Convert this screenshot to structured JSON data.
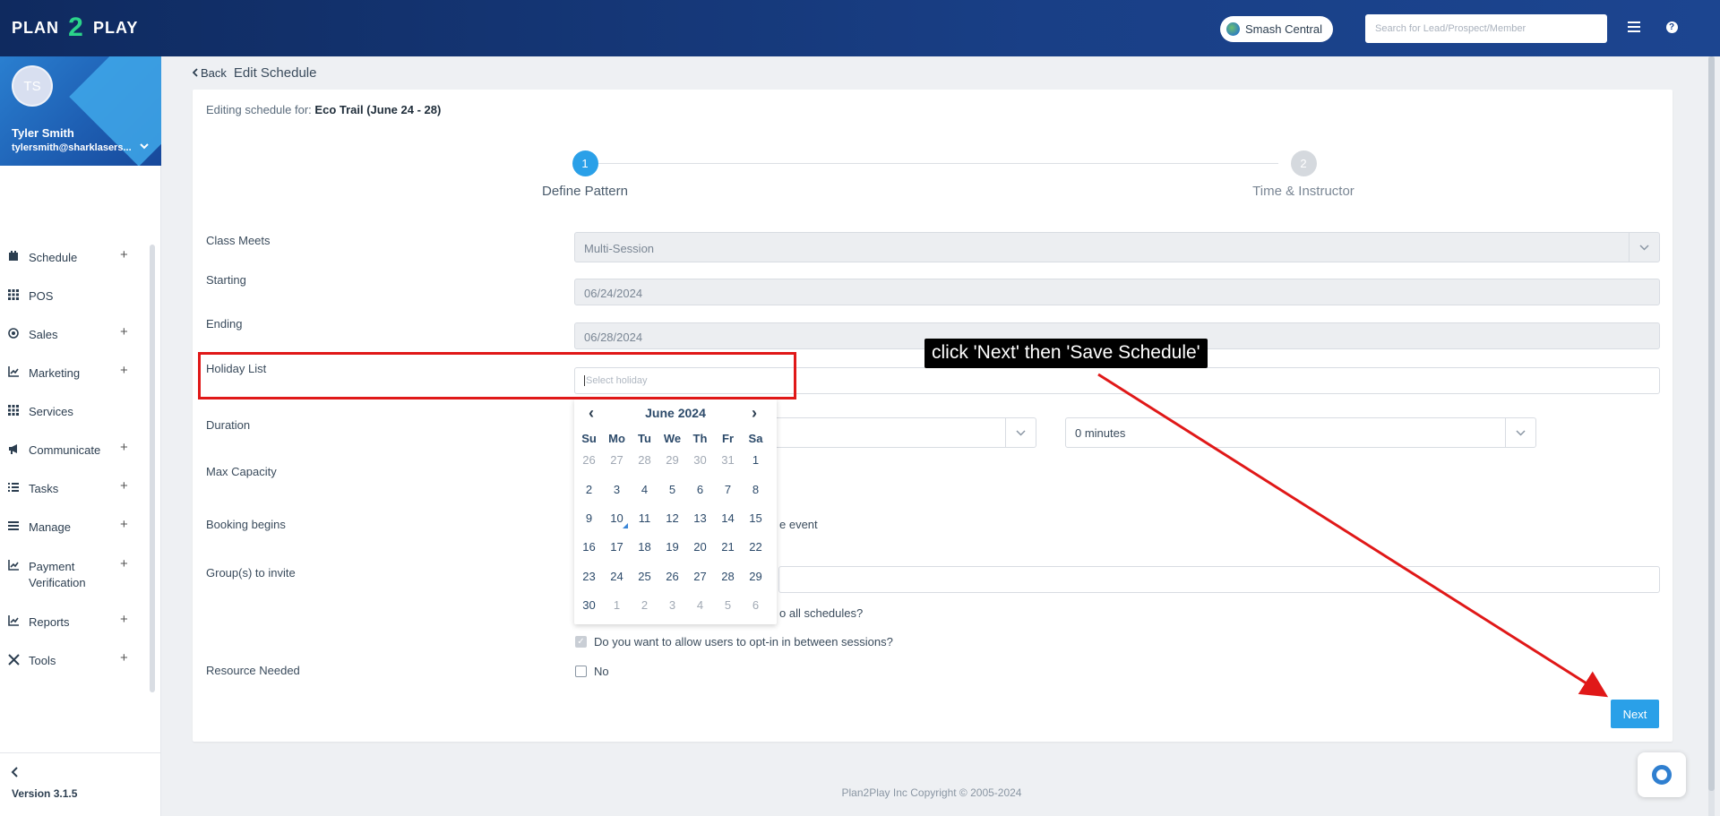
{
  "topbar": {
    "logo_left": "PLAN",
    "logo_mid": "2",
    "logo_right": "PLAY",
    "location": "Smash Central",
    "search_placeholder": "Search for Lead/Prospect/Member",
    "menu_icon": "hamburger-icon",
    "help_icon": "help-icon"
  },
  "profile": {
    "initials": "TS",
    "name": "Tyler Smith",
    "email": "tylersmith@sharklasers..."
  },
  "sidebar": {
    "items": [
      {
        "label": "Schedule",
        "icon": "calendar-icon",
        "expandable": true
      },
      {
        "label": "POS",
        "icon": "grid-icon",
        "expandable": false
      },
      {
        "label": "Sales",
        "icon": "target-icon",
        "expandable": true
      },
      {
        "label": "Marketing",
        "icon": "chart-icon",
        "expandable": true
      },
      {
        "label": "Services",
        "icon": "grid-icon",
        "expandable": false
      },
      {
        "label": "Communicate",
        "icon": "megaphone-icon",
        "expandable": true
      },
      {
        "label": "Tasks",
        "icon": "list-icon",
        "expandable": true
      },
      {
        "label": "Manage",
        "icon": "menu-icon",
        "expandable": true
      },
      {
        "label": "Payment",
        "label2": "Verification",
        "icon": "chart-icon",
        "expandable": true
      },
      {
        "label": "Reports",
        "icon": "chart-icon",
        "expandable": true
      },
      {
        "label": "Tools",
        "icon": "tools-icon",
        "expandable": true
      }
    ],
    "version": "Version 3.1.5"
  },
  "breadcrumb": {
    "back": "Back",
    "title": "Edit Schedule"
  },
  "form": {
    "editing_prefix": "Editing schedule for:",
    "editing_name": "Eco Trail (June 24 - 28)",
    "steps": [
      {
        "number": "1",
        "label": "Define Pattern",
        "active": true
      },
      {
        "number": "2",
        "label": "Time & Instructor",
        "active": false
      }
    ],
    "class_meets_label": "Class Meets",
    "class_meets_value": "Multi-Session",
    "starting_label": "Starting",
    "starting_value": "06/24/2024",
    "ending_label": "Ending",
    "ending_value": "06/28/2024",
    "holiday_label": "Holiday List",
    "holiday_placeholder": "Select holiday",
    "duration_label": "Duration",
    "duration_minutes": "0 minutes",
    "max_capacity_label": "Max Capacity",
    "booking_label": "Booking begins",
    "booking_tail": "e event",
    "groups_label": "Group(s) to invite",
    "apply_all_tail": "o all schedules?",
    "opt_in_text": "Do you want to allow users to opt-in in between sessions?",
    "resource_label": "Resource Needed",
    "resource_value": "No",
    "next_label": "Next"
  },
  "calendar": {
    "month_label": "June 2024",
    "prev": "‹",
    "next": "›",
    "dow": [
      "Su",
      "Mo",
      "Tu",
      "We",
      "Th",
      "Fr",
      "Sa"
    ],
    "weeks": [
      [
        "26",
        "27",
        "28",
        "29",
        "30",
        "31",
        "1"
      ],
      [
        "2",
        "3",
        "4",
        "5",
        "6",
        "7",
        "8"
      ],
      [
        "9",
        "10",
        "11",
        "12",
        "13",
        "14",
        "15"
      ],
      [
        "16",
        "17",
        "18",
        "19",
        "20",
        "21",
        "22"
      ],
      [
        "23",
        "24",
        "25",
        "26",
        "27",
        "28",
        "29"
      ],
      [
        "30",
        "1",
        "2",
        "3",
        "4",
        "5",
        "6"
      ]
    ],
    "muted_leading_count": 6,
    "muted_trailing_count": 6,
    "today": "10"
  },
  "footer": {
    "copyright": "Plan2Play Inc Copyright © 2005-2024"
  },
  "annotation": {
    "text": "click 'Next' then 'Save Schedule'",
    "color": "#e01818"
  },
  "colors": {
    "accent": "#2aa0e8",
    "topbar": "#193f86",
    "step_active": "#2aa0e8",
    "step_inactive": "#d5d9de"
  }
}
